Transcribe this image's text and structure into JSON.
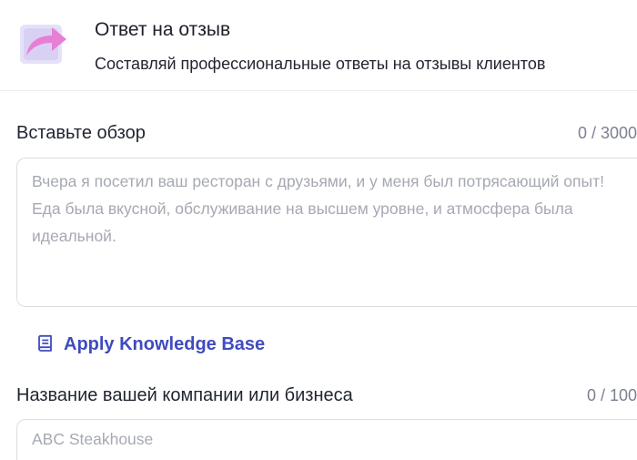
{
  "header": {
    "icon": "reply-arrow-icon",
    "title": "Ответ на отзыв",
    "subtitle": "Составляй профессиональные ответы на отзывы клиентов"
  },
  "review": {
    "label": "Вставьте обзор",
    "counter": "0 / 3000",
    "placeholder": "Вчера я посетил ваш ресторан с друзьями, и у меня был потрясающий опыт! Еда была вкусной, обслуживание на высшем уровне, и атмосфера была идеальной.",
    "value": ""
  },
  "knowledge_base": {
    "icon": "book-icon",
    "label": "Apply Knowledge Base",
    "color": "#3f4bbf"
  },
  "company": {
    "label": "Название вашей компании или бизнеса",
    "counter": "0 / 100",
    "placeholder": "ABC Steakhouse",
    "value": ""
  },
  "colors": {
    "accent": "#3f4bbf",
    "icon_bg": "#ede6fb",
    "icon_arrow": "#e77fd4",
    "border": "#dcdde3",
    "placeholder": "#a6a9b3",
    "counter": "#7c8191"
  }
}
